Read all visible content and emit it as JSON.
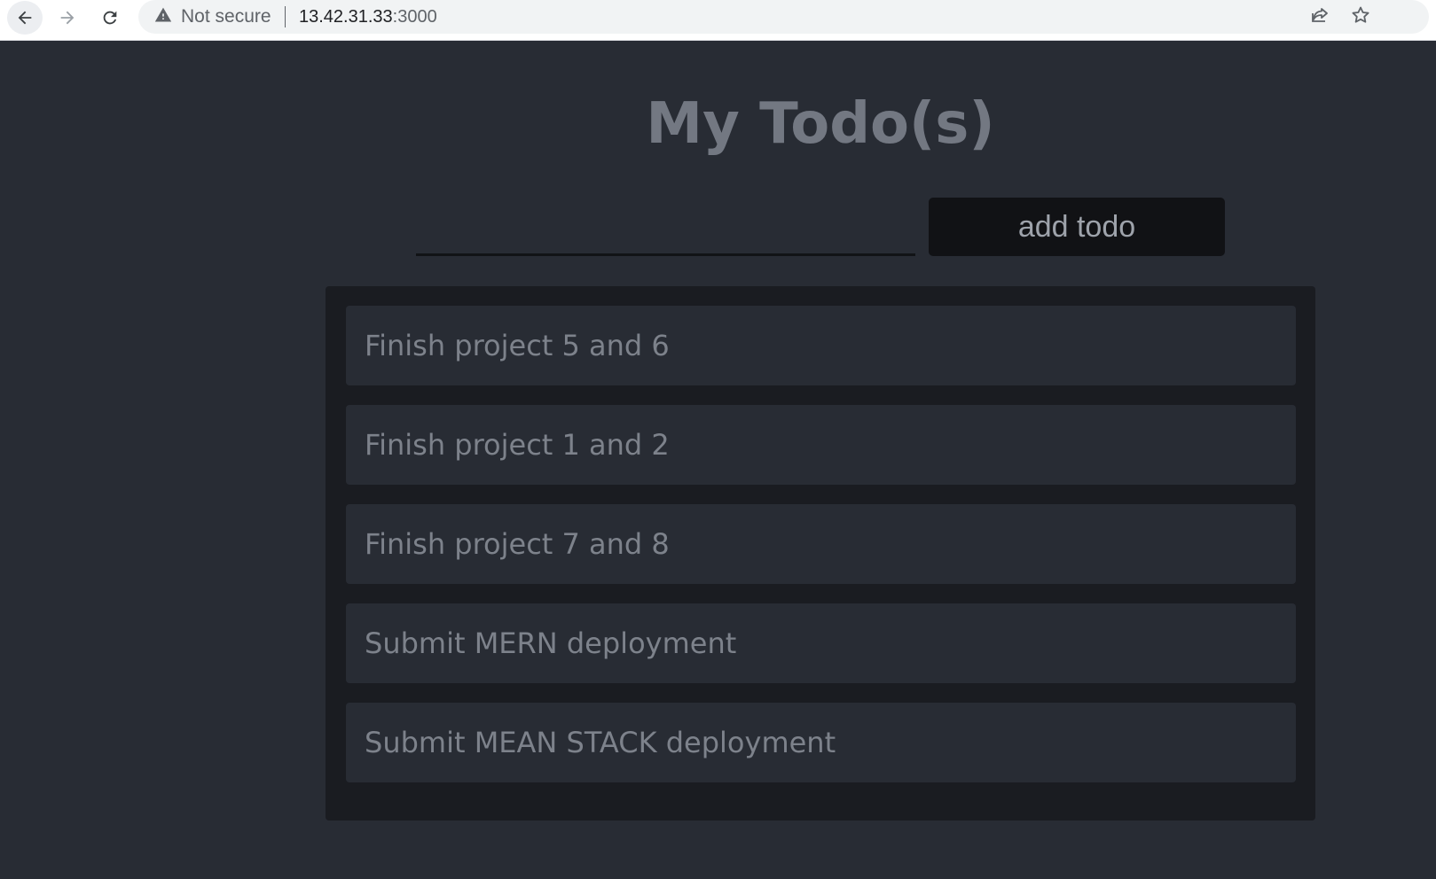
{
  "browser": {
    "security_label": "Not secure",
    "url_host": "13.42.31.33",
    "url_port": ":3000",
    "icons": [
      "back-arrow-icon",
      "forward-arrow-icon",
      "reload-icon",
      "warning-icon",
      "share-icon",
      "star-icon"
    ]
  },
  "app": {
    "title": "My Todo(s)",
    "input_value": "",
    "add_button_label": "add todo",
    "todos": [
      {
        "text": "Finish project 5 and 6"
      },
      {
        "text": "Finish project 1 and 2"
      },
      {
        "text": "Finish project 7 and 8"
      },
      {
        "text": "Submit MERN deployment"
      },
      {
        "text": "Submit MEAN STACK deployment"
      }
    ]
  },
  "colors": {
    "page_background": "#282c34",
    "list_background": "#1a1c21",
    "button_background": "#111215",
    "text_muted": "#7d828b"
  }
}
